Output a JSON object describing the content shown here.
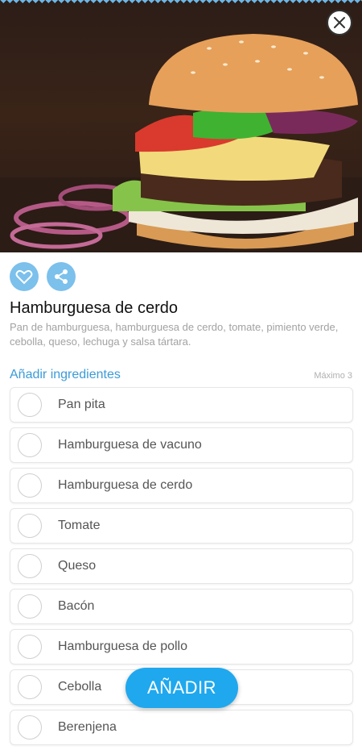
{
  "product": {
    "title": "Hamburguesa de cerdo",
    "description": "Pan de hamburguesa, hamburguesa de cerdo, tomate, pimiento verde, cebolla, queso, lechuga y salsa tártara."
  },
  "ingredients": {
    "section_label": "Añadir ingredientes",
    "max_label": "Máximo 3",
    "items": [
      {
        "label": "Pan pita"
      },
      {
        "label": "Hamburguesa de vacuno"
      },
      {
        "label": "Hamburguesa de cerdo"
      },
      {
        "label": "Tomate"
      },
      {
        "label": "Queso"
      },
      {
        "label": "Bacón"
      },
      {
        "label": "Hamburguesa de pollo"
      },
      {
        "label": "Cebolla"
      },
      {
        "label": "Berenjena"
      }
    ]
  },
  "add_button": {
    "label": "AÑADIR"
  },
  "icons": {
    "close": "close-icon",
    "favorite": "heart-icon",
    "share": "share-icon"
  },
  "colors": {
    "accent": "#1fa8ee",
    "icon_bg": "#7cc0ec",
    "section": "#3b9bd8"
  }
}
